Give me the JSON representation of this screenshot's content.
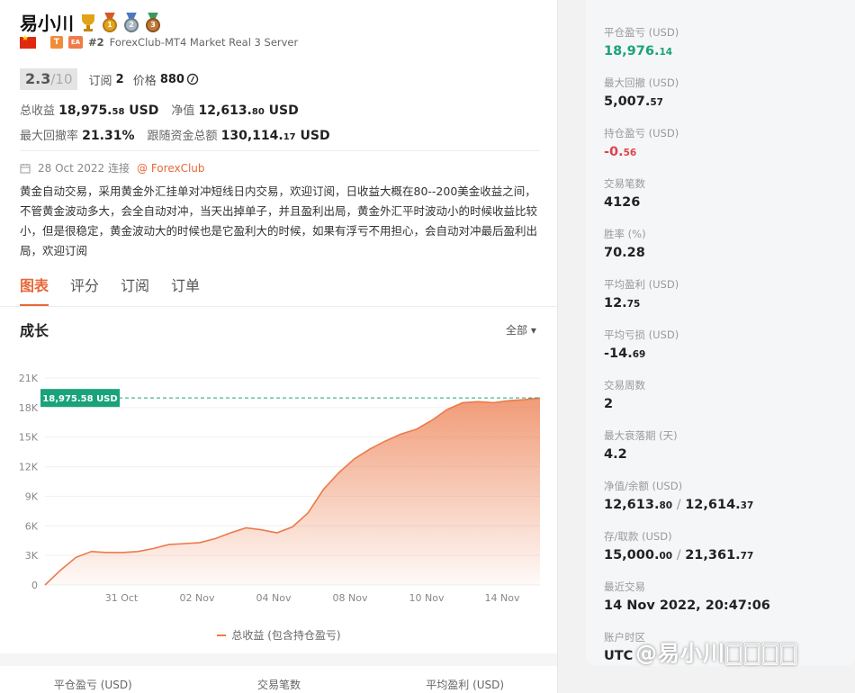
{
  "profile": {
    "name": "易小川",
    "badges": [
      "trophy-icon",
      "gold-medal-icon",
      "silver-medal-icon",
      "bronze-medal-icon"
    ],
    "tag_t": "T",
    "tag_ea": "EA",
    "rank": "#2",
    "server": "ForexClub-MT4 Market Real 3 Server",
    "score": "2.3",
    "score_max": "/10",
    "subscribe_label": "订阅",
    "subscribe_count": "2",
    "price_label": "价格",
    "price_value": "880",
    "price_icon": "coin-icon"
  },
  "stats": {
    "total_profit_label": "总收益",
    "total_profit_int": "18,975.",
    "total_profit_dec": "58",
    "total_profit_unit": "USD",
    "equity_label": "净值",
    "equity_int": "12,613.",
    "equity_dec": "80",
    "equity_unit": "USD",
    "drawdown_label": "最大回撤率",
    "drawdown_value": "21.31%",
    "follow_label": "跟随资金总额",
    "follow_int": "130,114.",
    "follow_dec": "17",
    "follow_unit": "USD"
  },
  "connection": {
    "date": "28 Oct 2022 连接",
    "broker": "@ ForexClub"
  },
  "description": "黄金自动交易，采用黄金外汇挂单对冲短线日内交易，欢迎订阅，日收益大概在80--200美金收益之间，不管黄金波动多大，会全自动对冲，当天出掉单子，并且盈利出局，黄金外汇平时波动小的时候收益比较小，但是很稳定，黄金波动大的时候也是它盈利大的时候，如果有浮亏不用担心，会自动对冲最后盈利出局，欢迎订阅",
  "tabs": [
    "图表",
    "评分",
    "订阅",
    "订单"
  ],
  "section": {
    "title": "成长",
    "range": "全部 ▾"
  },
  "chart_data": {
    "type": "area",
    "title": "",
    "y_ticks": [
      "0",
      "3K",
      "6K",
      "9K",
      "12K",
      "15K",
      "18K",
      "21K"
    ],
    "ylim": [
      0,
      21000
    ],
    "x_ticks": [
      "31 Oct",
      "02 Nov",
      "04 Nov",
      "08 Nov",
      "10 Nov",
      "14 Nov"
    ],
    "current_label": "18,975.58 USD",
    "current_value": 18975.58,
    "series": [
      {
        "name": "总收益 (包含持仓盈亏)",
        "values": [
          0,
          1500,
          2800,
          3400,
          3300,
          3300,
          3400,
          3700,
          4100,
          4200,
          4300,
          4700,
          5300,
          5800,
          5600,
          5300,
          5900,
          7300,
          9700,
          11400,
          12800,
          13800,
          14600,
          15300,
          15800,
          16700,
          17800,
          18500,
          18600,
          18500,
          18700,
          18800,
          18975.58
        ]
      }
    ],
    "color": "#ec7a4a"
  },
  "legend_label": "总收益 (包含持仓盈亏)",
  "bottom_stats": [
    "平仓盈亏 (USD)",
    "交易笔数",
    "平均盈利 (USD)"
  ],
  "side_stats": [
    {
      "label": "平仓盈亏 (USD)",
      "int": "18,976.",
      "dec": "14",
      "color": "#1aa37a"
    },
    {
      "label": "最大回撤 (USD)",
      "int": "5,007.",
      "dec": "57",
      "color": "#222222"
    },
    {
      "label": "持仓盈亏 (USD)",
      "int": "-0.",
      "dec": "56",
      "color": "#e0424e"
    },
    {
      "label": "交易笔数",
      "int": "4126",
      "dec": "",
      "color": "#222222"
    },
    {
      "label": "胜率 (%)",
      "int": "70.28",
      "dec": "",
      "color": "#222222"
    },
    {
      "label": "平均盈利 (USD)",
      "int": "12.",
      "dec": "75",
      "color": "#222222"
    },
    {
      "label": "平均亏损 (USD)",
      "int": "-14.",
      "dec": "69",
      "color": "#222222"
    },
    {
      "label": "交易周数",
      "int": "2",
      "dec": "",
      "color": "#222222"
    },
    {
      "label": "最大衰落期 (天)",
      "int": "4.2",
      "dec": "",
      "color": "#222222"
    },
    {
      "label": "净值/余额 (USD)",
      "int": "12,613.",
      "dec": "80",
      "extra_int": "12,614.",
      "extra_dec": "37",
      "color": "#222222"
    },
    {
      "label": "存/取款 (USD)",
      "int": "15,000.",
      "dec": "00",
      "extra_int": "21,361.",
      "extra_dec": "77",
      "color": "#222222"
    },
    {
      "label": "最近交易",
      "int": "14 Nov 2022, 20:47:06",
      "dec": "",
      "color": "#222222"
    },
    {
      "label": "账户时区",
      "int": "UTC",
      "dec": "",
      "color": "#222222"
    }
  ],
  "watermark": "@易小川🀆🀆🀆🀆"
}
